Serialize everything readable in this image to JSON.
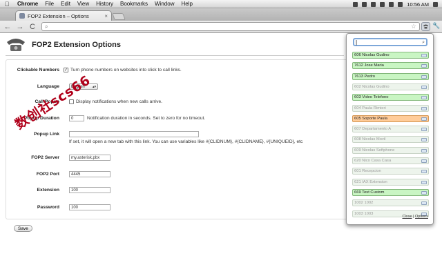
{
  "menubar": {
    "apple": "",
    "items": [
      "Chrome",
      "File",
      "Edit",
      "View",
      "History",
      "Bookmarks",
      "Window",
      "Help"
    ],
    "clock": "10:56 AM"
  },
  "browser": {
    "tab_title": "FOP2 Extension – Options",
    "tab_close": "×",
    "back": "←",
    "forward": "→",
    "reload": "C",
    "search_glyph": "⌕"
  },
  "page": {
    "title": "FOP2 Extension Options",
    "watermark": "数创社scs66",
    "clickable_numbers": {
      "label": "Clickable Numbers",
      "checked": "✓",
      "text": "Turn phone numbers on websites into click to call links."
    },
    "language": {
      "label": "Language",
      "value": "English"
    },
    "call_popup": {
      "label": "Call Popup",
      "text": "Display notifications when new calls arrive."
    },
    "popup_duration": {
      "label": "Popup Duration",
      "value": "0",
      "text": "Notification duration in seconds. Set to zero for no timeout."
    },
    "popup_link": {
      "label": "Popup Link",
      "value": "",
      "help": "If set, it will open a new tab with this link. You can use variables like #{CLIDNUM}, #{CLIDNAME}, #{UNIQUEID}, etc"
    },
    "server": {
      "label": "FOP2 Server",
      "value": "my.asterisk.pbx"
    },
    "port": {
      "label": "FOP2 Port",
      "value": "4445"
    },
    "extension": {
      "label": "Extension",
      "value": "100"
    },
    "password": {
      "label": "Password",
      "value": "100"
    },
    "save": "Save"
  },
  "popup": {
    "search_value": "|",
    "extensions": [
      {
        "label": "606 Nicolas Gudino",
        "state": "on"
      },
      {
        "label": "7612 Jose Maria",
        "state": "on"
      },
      {
        "label": "7613 Pedro",
        "state": "on"
      },
      {
        "label": "602 Nicolas Gudino",
        "state": "off"
      },
      {
        "label": "603 Video Telefono",
        "state": "on"
      },
      {
        "label": "604 Paula Rimieri",
        "state": "off"
      },
      {
        "label": "605 Soporte Paula",
        "state": "busy"
      },
      {
        "label": "607 Departamento A",
        "state": "off"
      },
      {
        "label": "608 Nicolas Movil",
        "state": "off"
      },
      {
        "label": "609 Nicolas Softphone",
        "state": "off"
      },
      {
        "label": "620 Nico Casa Casa",
        "state": "off"
      },
      {
        "label": "601 Recepcion",
        "state": "off"
      },
      {
        "label": "621 IAX Extension",
        "state": "off"
      },
      {
        "label": "669 Test Custom",
        "state": "on"
      },
      {
        "label": "1002 1002",
        "state": "off"
      },
      {
        "label": "1003 1003",
        "state": "off"
      }
    ],
    "close": "Close",
    "separator": " | ",
    "options": "Options"
  },
  "colors": {
    "available": "#c9f5c3",
    "offline": "#edf4ec",
    "busy": "#ffcc99",
    "watermark": "#b0001a"
  }
}
